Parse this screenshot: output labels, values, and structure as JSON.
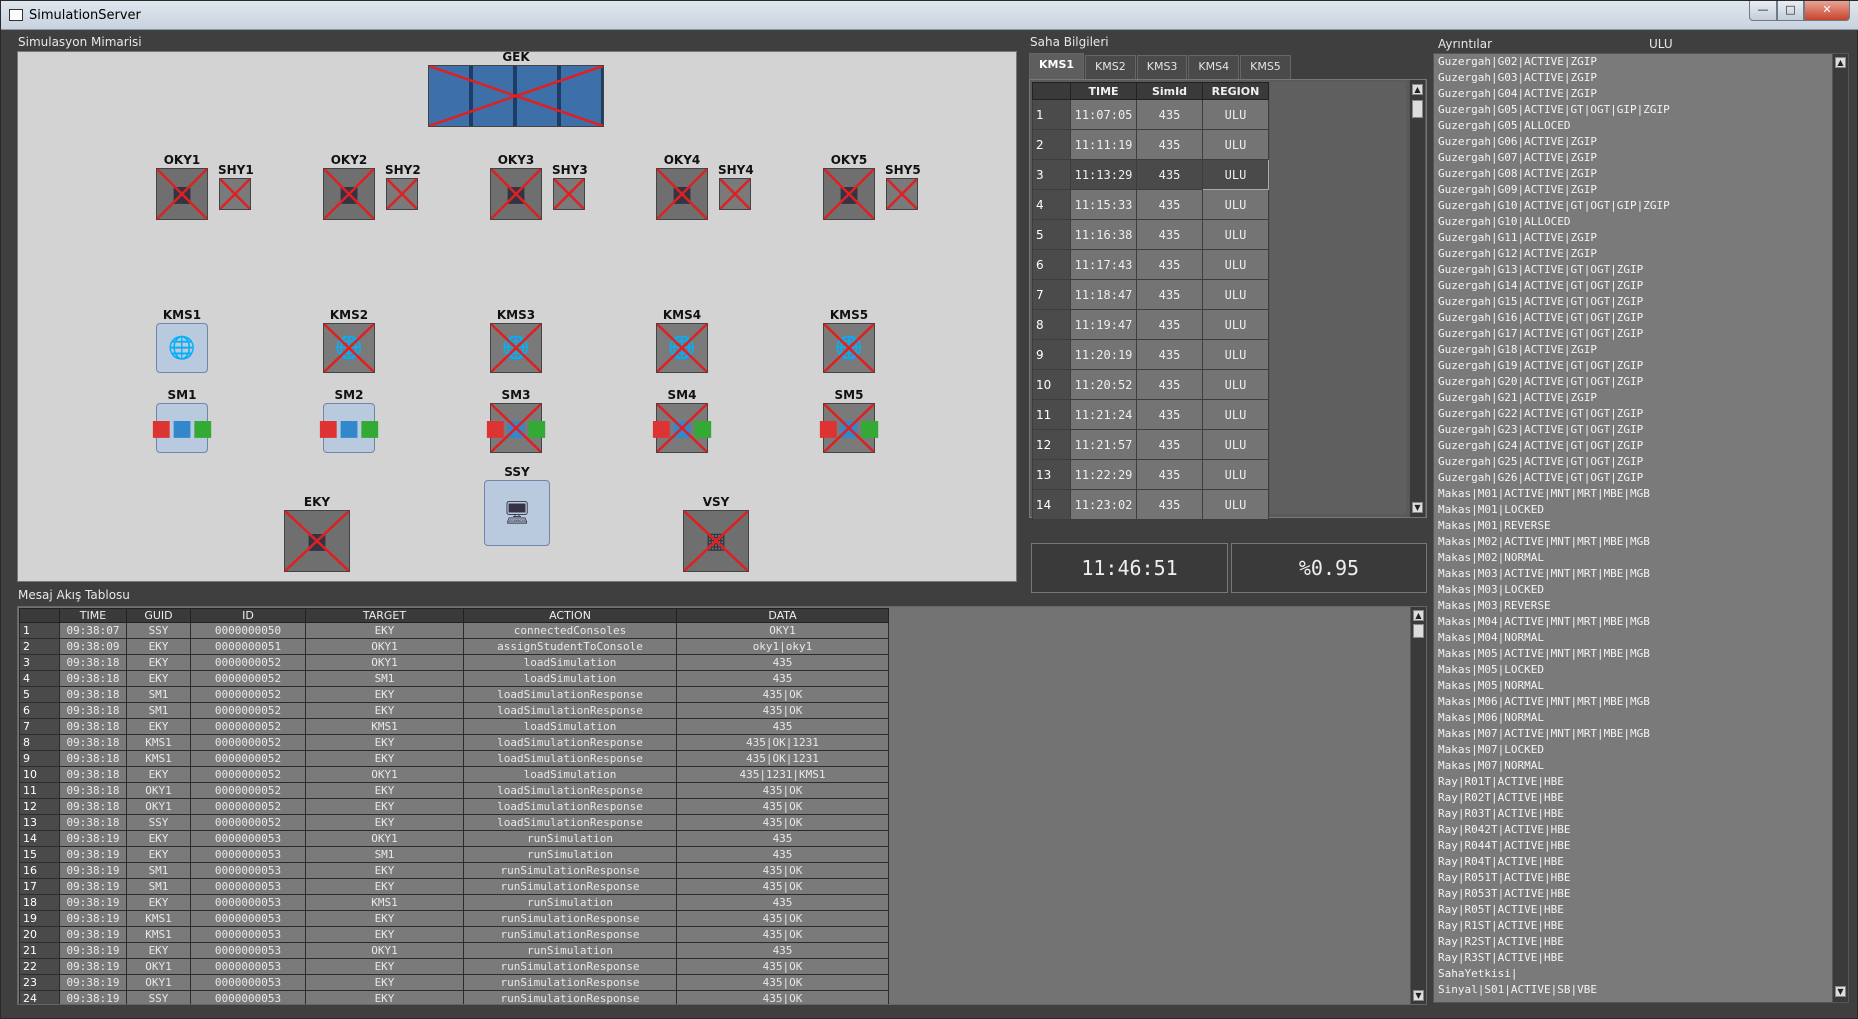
{
  "window": {
    "title": "SimulationServer"
  },
  "architecture": {
    "label": "Simulasyon Mimarisi",
    "gek": {
      "label": "GEK"
    },
    "oky": [
      {
        "label": "OKY1",
        "shy": "SHY1"
      },
      {
        "label": "OKY2",
        "shy": "SHY2"
      },
      {
        "label": "OKY3",
        "shy": "SHY3"
      },
      {
        "label": "OKY4",
        "shy": "SHY4"
      },
      {
        "label": "OKY5",
        "shy": "SHY5"
      }
    ],
    "kms": [
      {
        "label": "KMS1",
        "status": "active"
      },
      {
        "label": "KMS2",
        "status": "offline"
      },
      {
        "label": "KMS3",
        "status": "offline"
      },
      {
        "label": "KMS4",
        "status": "offline"
      },
      {
        "label": "KMS5",
        "status": "offline"
      }
    ],
    "sm": [
      {
        "label": "SM1",
        "status": "active"
      },
      {
        "label": "SM2",
        "status": "active"
      },
      {
        "label": "SM3",
        "status": "offline"
      },
      {
        "label": "SM4",
        "status": "offline"
      },
      {
        "label": "SM5",
        "status": "offline"
      }
    ],
    "eky": {
      "label": "EKY"
    },
    "ssy": {
      "label": "SSY"
    },
    "vsy": {
      "label": "VSY"
    }
  },
  "saha": {
    "label": "Saha Bilgileri",
    "tabs": [
      "KMS1",
      "KMS2",
      "KMS3",
      "KMS4",
      "KMS5"
    ],
    "active_tab": "KMS1",
    "columns": [
      "TIME",
      "SimId",
      "REGION"
    ],
    "rows": [
      {
        "n": "1",
        "time": "11:07:05",
        "simid": "435",
        "region": "ULU"
      },
      {
        "n": "2",
        "time": "11:11:19",
        "simid": "435",
        "region": "ULU"
      },
      {
        "n": "3",
        "time": "11:13:29",
        "simid": "435",
        "region": "ULU"
      },
      {
        "n": "4",
        "time": "11:15:33",
        "simid": "435",
        "region": "ULU"
      },
      {
        "n": "5",
        "time": "11:16:38",
        "simid": "435",
        "region": "ULU"
      },
      {
        "n": "6",
        "time": "11:17:43",
        "simid": "435",
        "region": "ULU"
      },
      {
        "n": "7",
        "time": "11:18:47",
        "simid": "435",
        "region": "ULU"
      },
      {
        "n": "8",
        "time": "11:19:47",
        "simid": "435",
        "region": "ULU"
      },
      {
        "n": "9",
        "time": "11:20:19",
        "simid": "435",
        "region": "ULU"
      },
      {
        "n": "10",
        "time": "11:20:52",
        "simid": "435",
        "region": "ULU"
      },
      {
        "n": "11",
        "time": "11:21:24",
        "simid": "435",
        "region": "ULU"
      },
      {
        "n": "12",
        "time": "11:21:57",
        "simid": "435",
        "region": "ULU"
      },
      {
        "n": "13",
        "time": "11:22:29",
        "simid": "435",
        "region": "ULU"
      },
      {
        "n": "14",
        "time": "11:23:02",
        "simid": "435",
        "region": "ULU"
      }
    ],
    "selected_row": 3,
    "clock": "11:46:51",
    "percent": "%0.95"
  },
  "details": {
    "label": "Ayrıntılar",
    "region": "ULU",
    "lines": [
      "Guzergah|G02|ACTIVE|ZGIP",
      "Guzergah|G03|ACTIVE|ZGIP",
      "Guzergah|G04|ACTIVE|ZGIP",
      "Guzergah|G05|ACTIVE|GT|OGT|GIP|ZGIP",
      "Guzergah|G05|ALLOCED",
      "Guzergah|G06|ACTIVE|ZGIP",
      "Guzergah|G07|ACTIVE|ZGIP",
      "Guzergah|G08|ACTIVE|ZGIP",
      "Guzergah|G09|ACTIVE|ZGIP",
      "Guzergah|G10|ACTIVE|GT|OGT|GIP|ZGIP",
      "Guzergah|G10|ALLOCED",
      "Guzergah|G11|ACTIVE|ZGIP",
      "Guzergah|G12|ACTIVE|ZGIP",
      "Guzergah|G13|ACTIVE|GT|OGT|ZGIP",
      "Guzergah|G14|ACTIVE|GT|OGT|ZGIP",
      "Guzergah|G15|ACTIVE|GT|OGT|ZGIP",
      "Guzergah|G16|ACTIVE|GT|OGT|ZGIP",
      "Guzergah|G17|ACTIVE|GT|OGT|ZGIP",
      "Guzergah|G18|ACTIVE|ZGIP",
      "Guzergah|G19|ACTIVE|GT|OGT|ZGIP",
      "Guzergah|G20|ACTIVE|GT|OGT|ZGIP",
      "Guzergah|G21|ACTIVE|ZGIP",
      "Guzergah|G22|ACTIVE|GT|OGT|ZGIP",
      "Guzergah|G23|ACTIVE|GT|OGT|ZGIP",
      "Guzergah|G24|ACTIVE|GT|OGT|ZGIP",
      "Guzergah|G25|ACTIVE|GT|OGT|ZGIP",
      "Guzergah|G26|ACTIVE|GT|OGT|ZGIP",
      "Makas|M01|ACTIVE|MNT|MRT|MBE|MGB",
      "Makas|M01|LOCKED",
      "Makas|M01|REVERSE",
      "Makas|M02|ACTIVE|MNT|MRT|MBE|MGB",
      "Makas|M02|NORMAL",
      "Makas|M03|ACTIVE|MNT|MRT|MBE|MGB",
      "Makas|M03|LOCKED",
      "Makas|M03|REVERSE",
      "Makas|M04|ACTIVE|MNT|MRT|MBE|MGB",
      "Makas|M04|NORMAL",
      "Makas|M05|ACTIVE|MNT|MRT|MBE|MGB",
      "Makas|M05|LOCKED",
      "Makas|M05|NORMAL",
      "Makas|M06|ACTIVE|MNT|MRT|MBE|MGB",
      "Makas|M06|NORMAL",
      "Makas|M07|ACTIVE|MNT|MRT|MBE|MGB",
      "Makas|M07|LOCKED",
      "Makas|M07|NORMAL",
      "Ray|R01T|ACTIVE|HBE",
      "Ray|R02T|ACTIVE|HBE",
      "Ray|R03T|ACTIVE|HBE",
      "Ray|R042T|ACTIVE|HBE",
      "Ray|R044T|ACTIVE|HBE",
      "Ray|R04T|ACTIVE|HBE",
      "Ray|R051T|ACTIVE|HBE",
      "Ray|R053T|ACTIVE|HBE",
      "Ray|R05T|ACTIVE|HBE",
      "Ray|R1ST|ACTIVE|HBE",
      "Ray|R2ST|ACTIVE|HBE",
      "Ray|R3ST|ACTIVE|HBE",
      "SahaYetkisi|",
      "Sinyal|S01|ACTIVE|SB|VBE"
    ]
  },
  "messages": {
    "label": "Mesaj Akış Tablosu",
    "columns": [
      "TIME",
      "GUID",
      "ID",
      "TARGET",
      "ACTION",
      "DATA"
    ],
    "rows": [
      [
        "1",
        "09:38:07",
        "SSY",
        "0000000050",
        "EKY",
        "connectedConsoles",
        "OKY1"
      ],
      [
        "2",
        "09:38:09",
        "EKY",
        "0000000051",
        "OKY1",
        "assignStudentToConsole",
        "oky1|oky1"
      ],
      [
        "3",
        "09:38:18",
        "EKY",
        "0000000052",
        "OKY1",
        "loadSimulation",
        "435"
      ],
      [
        "4",
        "09:38:18",
        "EKY",
        "0000000052",
        "SM1",
        "loadSimulation",
        "435"
      ],
      [
        "5",
        "09:38:18",
        "SM1",
        "0000000052",
        "EKY",
        "loadSimulationResponse",
        "435|OK"
      ],
      [
        "6",
        "09:38:18",
        "SM1",
        "0000000052",
        "EKY",
        "loadSimulationResponse",
        "435|OK"
      ],
      [
        "7",
        "09:38:18",
        "EKY",
        "0000000052",
        "KMS1",
        "loadSimulation",
        "435"
      ],
      [
        "8",
        "09:38:18",
        "KMS1",
        "0000000052",
        "EKY",
        "loadSimulationResponse",
        "435|OK|1231"
      ],
      [
        "9",
        "09:38:18",
        "KMS1",
        "0000000052",
        "EKY",
        "loadSimulationResponse",
        "435|OK|1231"
      ],
      [
        "10",
        "09:38:18",
        "EKY",
        "0000000052",
        "OKY1",
        "loadSimulation",
        "435|1231|KMS1"
      ],
      [
        "11",
        "09:38:18",
        "OKY1",
        "0000000052",
        "EKY",
        "loadSimulationResponse",
        "435|OK"
      ],
      [
        "12",
        "09:38:18",
        "OKY1",
        "0000000052",
        "EKY",
        "loadSimulationResponse",
        "435|OK"
      ],
      [
        "13",
        "09:38:18",
        "SSY",
        "0000000052",
        "EKY",
        "loadSimulationResponse",
        "435|OK"
      ],
      [
        "14",
        "09:38:19",
        "EKY",
        "0000000053",
        "OKY1",
        "runSimulation",
        "435"
      ],
      [
        "15",
        "09:38:19",
        "EKY",
        "0000000053",
        "SM1",
        "runSimulation",
        "435"
      ],
      [
        "16",
        "09:38:19",
        "SM1",
        "0000000053",
        "EKY",
        "runSimulationResponse",
        "435|OK"
      ],
      [
        "17",
        "09:38:19",
        "SM1",
        "0000000053",
        "EKY",
        "runSimulationResponse",
        "435|OK"
      ],
      [
        "18",
        "09:38:19",
        "EKY",
        "0000000053",
        "KMS1",
        "runSimulation",
        "435"
      ],
      [
        "19",
        "09:38:19",
        "KMS1",
        "0000000053",
        "EKY",
        "runSimulationResponse",
        "435|OK"
      ],
      [
        "20",
        "09:38:19",
        "KMS1",
        "0000000053",
        "EKY",
        "runSimulationResponse",
        "435|OK"
      ],
      [
        "21",
        "09:38:19",
        "EKY",
        "0000000053",
        "OKY1",
        "runSimulation",
        "435"
      ],
      [
        "22",
        "09:38:19",
        "OKY1",
        "0000000053",
        "EKY",
        "runSimulationResponse",
        "435|OK"
      ],
      [
        "23",
        "09:38:19",
        "OKY1",
        "0000000053",
        "EKY",
        "runSimulationResponse",
        "435|OK"
      ],
      [
        "24",
        "09:38:19",
        "SSY",
        "0000000053",
        "EKY",
        "runSimulationResponse",
        "435|OK"
      ]
    ]
  },
  "colors": {
    "offline_cross": "#e02020",
    "panel_bg": "#d3d3d3",
    "window_bg": "#3f3f3f"
  }
}
